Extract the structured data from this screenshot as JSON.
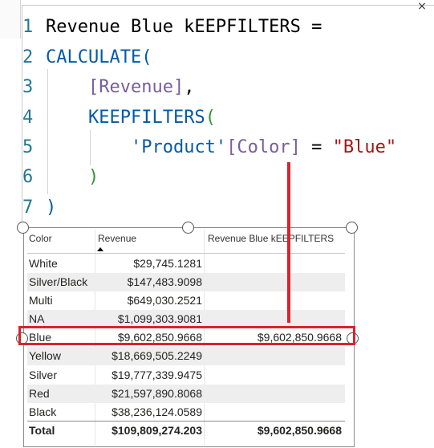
{
  "editor": {
    "line_numbers": [
      "1",
      "2",
      "3",
      "4",
      "5",
      "6",
      "7"
    ],
    "lines": [
      [
        {
          "t": "Revenue Blue kEEPFILTERS =",
          "c": "plain"
        }
      ],
      [
        {
          "t": "CALCULATE",
          "c": "fn"
        },
        {
          "t": "(",
          "c": "par1"
        }
      ],
      [
        {
          "t": "    ",
          "c": "plain"
        },
        {
          "t": "[Revenue]",
          "c": "meas"
        },
        {
          "t": ",",
          "c": "plain"
        }
      ],
      [
        {
          "t": "    ",
          "c": "plain"
        },
        {
          "t": "KEEPFILTERS",
          "c": "fn"
        },
        {
          "t": "(",
          "c": "par2"
        }
      ],
      [
        {
          "t": "        ",
          "c": "plain"
        },
        {
          "t": "'Product'",
          "c": "fn"
        },
        {
          "t": "[Color]",
          "c": "meas"
        },
        {
          "t": " = ",
          "c": "plain"
        },
        {
          "t": "\"Blue\"",
          "c": "str"
        }
      ],
      [
        {
          "t": "    ",
          "c": "plain"
        },
        {
          "t": ")",
          "c": "par2"
        }
      ],
      [
        {
          "t": ")",
          "c": "par1"
        }
      ]
    ],
    "close_glyph": "×"
  },
  "table": {
    "headers": {
      "color": "Color",
      "revenue": "Revenue",
      "revenue_blue": "Revenue Blue kEEPFILTERS"
    },
    "rows": [
      {
        "color": "White",
        "revenue": "$29,745.1281",
        "revenue_blue": ""
      },
      {
        "color": "Silver/Black",
        "revenue": "$147,483.9098",
        "revenue_blue": ""
      },
      {
        "color": "Multi",
        "revenue": "$649,030.2521",
        "revenue_blue": ""
      },
      {
        "color": "NA",
        "revenue": "$1,099,303.9081",
        "revenue_blue": ""
      },
      {
        "color": "Blue",
        "revenue": "$9,602,850.9668",
        "revenue_blue": "$9,602,850.9668"
      },
      {
        "color": "Yellow",
        "revenue": "$18,669,505.2249",
        "revenue_blue": ""
      },
      {
        "color": "Silver",
        "revenue": "$19,777,339.9475",
        "revenue_blue": ""
      },
      {
        "color": "Red",
        "revenue": "$21,597,890.8068",
        "revenue_blue": ""
      },
      {
        "color": "Black",
        "revenue": "$38,236,124.0589",
        "revenue_blue": ""
      }
    ],
    "total": {
      "color": "Total",
      "revenue": "$109,809,274.203",
      "revenue_blue": "$9,602,850.9668"
    },
    "sorted_column": "revenue",
    "sort_direction": "ascending"
  },
  "colors": {
    "highlight": "#d9232e",
    "function": "#035aa6",
    "measure": "#795e9c",
    "string": "#a31515"
  }
}
